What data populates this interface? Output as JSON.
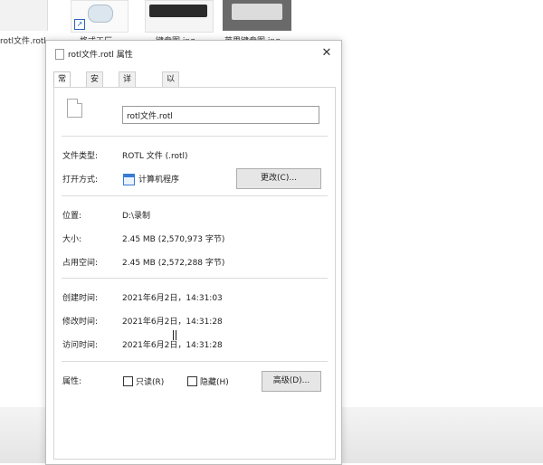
{
  "desktop": {
    "files": [
      {
        "label": "rotl文件.rotl"
      },
      {
        "label": "格式工厂"
      },
      {
        "label": "键盘图.jpg"
      },
      {
        "label": "苹果键盘图.jpg"
      }
    ]
  },
  "window": {
    "title": "rotl文件.rotl 属性",
    "close_glyph": "✕",
    "tabs": [
      {
        "label": "常规"
      },
      {
        "label": "安全"
      },
      {
        "label": "详细信息"
      },
      {
        "label": "以前的版本"
      }
    ],
    "general": {
      "filename": "rotl文件.rotl",
      "file_type_label": "文件类型:",
      "file_type_value": "ROTL 文件 (.rotl)",
      "open_with_label": "打开方式:",
      "open_with_value": "计算机程序",
      "change_button": "更改(C)...",
      "location_label": "位置:",
      "location_value": "D:\\录制",
      "size_label": "大小:",
      "size_value": "2.45 MB (2,570,973 字节)",
      "size_on_disk_label": "占用空间:",
      "size_on_disk_value": "2.45 MB (2,572,288 字节)",
      "created_label": "创建时间:",
      "created_value": "2021年6月2日，14:31:03",
      "modified_label": "修改时间:",
      "modified_value": "2021年6月2日，14:31:28",
      "accessed_label": "访问时间:",
      "accessed_value": "2021年6月2日，14:31:28",
      "attributes_label": "属性:",
      "readonly_label": "只读(R)",
      "hidden_label": "隐藏(H)",
      "advanced_button": "高级(D)..."
    }
  },
  "colors": {
    "button_bg": "#e6e6e6",
    "accent": "#3a7bd5"
  },
  "icons": [
    "document-icon",
    "application-icon",
    "close-icon",
    "shortcut-arrow-icon",
    "text-cursor-icon"
  ]
}
